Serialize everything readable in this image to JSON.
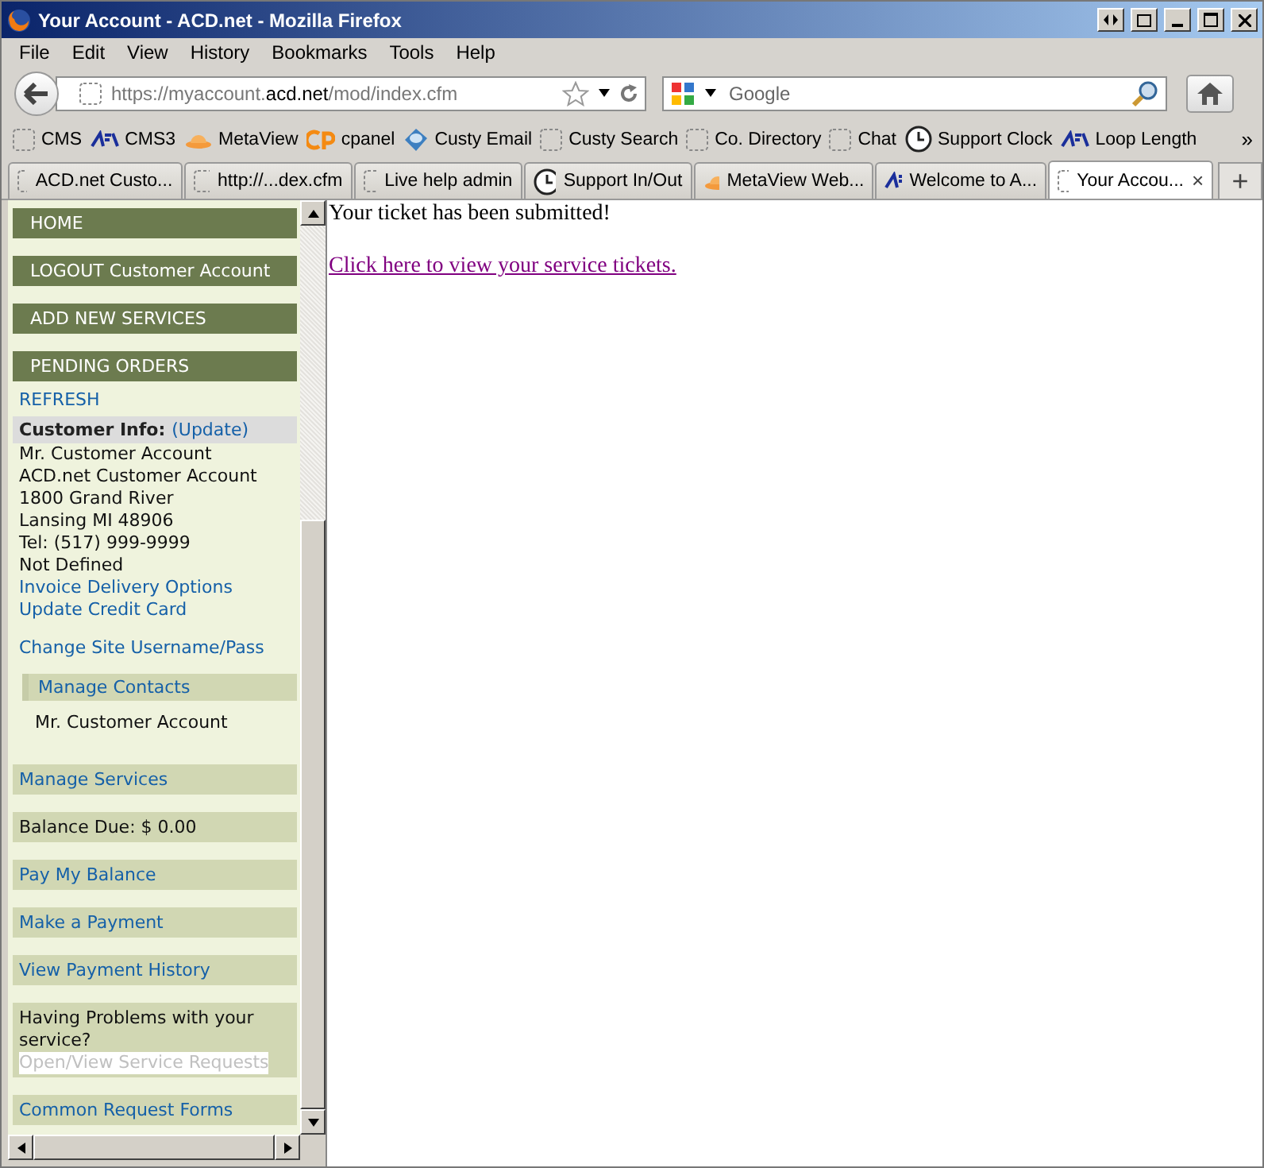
{
  "window": {
    "title": "Your Account - ACD.net - Mozilla Firefox"
  },
  "menu": [
    "File",
    "Edit",
    "View",
    "History",
    "Bookmarks",
    "Tools",
    "Help"
  ],
  "navbar": {
    "url": "https://myaccount.**acd.net**/mod/index.cfm",
    "search_placeholder": "Google"
  },
  "bookmarks": [
    {
      "label": "CMS",
      "kind": "page"
    },
    {
      "label": "CMS3",
      "kind": "logo"
    },
    {
      "label": "MetaView",
      "kind": "dome"
    },
    {
      "label": "cpanel",
      "kind": "cp"
    },
    {
      "label": "Custy Email",
      "kind": "globe"
    },
    {
      "label": "Custy Search",
      "kind": "page"
    },
    {
      "label": "Co. Directory",
      "kind": "page"
    },
    {
      "label": "Chat",
      "kind": "page"
    },
    {
      "label": "Support Clock",
      "kind": "clock"
    },
    {
      "label": "Loop Length",
      "kind": "logo"
    }
  ],
  "bookmarks_overflow": "»",
  "tabs": [
    {
      "label": "ACD.net Custo...",
      "kind": "page",
      "selected": false
    },
    {
      "label": "http://...dex.cfm",
      "kind": "page",
      "selected": false
    },
    {
      "label": "Live help admin",
      "kind": "page",
      "selected": false
    },
    {
      "label": "Support In/Out",
      "kind": "clock",
      "selected": false
    },
    {
      "label": "MetaView Web...",
      "kind": "dome",
      "selected": false
    },
    {
      "label": "Welcome to A...",
      "kind": "logo",
      "selected": false
    },
    {
      "label": "Your Accou...",
      "kind": "page",
      "selected": true
    }
  ],
  "tab_close": "×",
  "new_tab": "+",
  "sidebar": [
    {
      "kind": "header",
      "text": "HOME"
    },
    {
      "kind": "header",
      "text": "LOGOUT Customer Account"
    },
    {
      "kind": "header",
      "text": "ADD NEW SERVICES"
    },
    {
      "kind": "header",
      "text": "PENDING ORDERS"
    },
    {
      "kind": "link",
      "text": "REFRESH"
    },
    {
      "kind": "info",
      "heading": "Customer Info:",
      "heading_link": "(Update)",
      "lines": [
        "Mr. Customer Account",
        "ACD.net Customer Account",
        "1800 Grand River",
        "Lansing MI 48906",
        "Tel: (517) 999-9999",
        "Not Defined"
      ],
      "links": [
        "Invoice Delivery Options",
        "Update Credit Card"
      ]
    },
    {
      "kind": "link",
      "text": "Change Site Username/Pass"
    },
    {
      "kind": "contacts",
      "text": "Manage Contacts",
      "lines": [
        "Mr. Customer Account"
      ]
    },
    {
      "kind": "bar-link",
      "text": "Manage Services"
    },
    {
      "kind": "bar-text",
      "text": "Balance Due: $ 0.00"
    },
    {
      "kind": "bar-link",
      "text": "Pay My Balance"
    },
    {
      "kind": "bar-link",
      "text": "Make a Payment"
    },
    {
      "kind": "bar-link",
      "text": "View Payment History"
    },
    {
      "kind": "problems",
      "text": "Having Problems with your service?",
      "link": "Open/View Service Requests"
    },
    {
      "kind": "bar-link",
      "text": "Common Request Forms"
    }
  ],
  "main": {
    "message": "Your ticket has been submitted!",
    "link": "Click here to view your service tickets."
  }
}
